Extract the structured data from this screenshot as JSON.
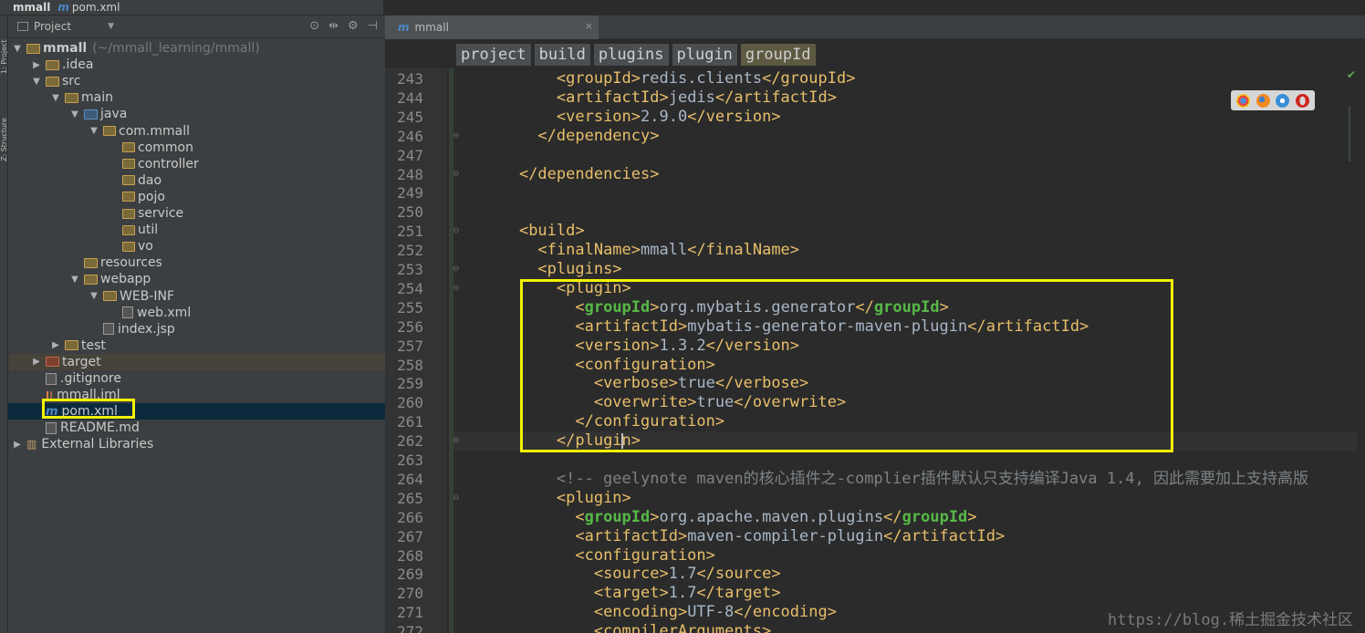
{
  "breadcrumb": {
    "project": "mmall",
    "file": "pom.xml",
    "file_icon": "m"
  },
  "side_strip": {
    "labels": [
      "1: Project",
      "Z: Structure"
    ]
  },
  "project_panel": {
    "title": "Project",
    "dropdown_icon": "chevron-down-icon",
    "tools": [
      "target-icon",
      "collapse-icon",
      "gear-icon",
      "hide-icon"
    ],
    "tree": [
      {
        "label": "mmall",
        "extra": "(~/mmall_learning/mmall)",
        "indent": 0,
        "arrow": "open",
        "icon": "module-folder",
        "bold": true
      },
      {
        "label": ".idea",
        "indent": 1,
        "arrow": "closed",
        "icon": "folder"
      },
      {
        "label": "src",
        "indent": 1,
        "arrow": "open",
        "icon": "folder"
      },
      {
        "label": "main",
        "indent": 2,
        "arrow": "open",
        "icon": "folder"
      },
      {
        "label": "java",
        "indent": 3,
        "arrow": "open",
        "icon": "source-folder"
      },
      {
        "label": "com.mmall",
        "indent": 4,
        "arrow": "open",
        "icon": "package"
      },
      {
        "label": "common",
        "indent": 5,
        "arrow": "",
        "icon": "package"
      },
      {
        "label": "controller",
        "indent": 5,
        "arrow": "",
        "icon": "package"
      },
      {
        "label": "dao",
        "indent": 5,
        "arrow": "",
        "icon": "package"
      },
      {
        "label": "pojo",
        "indent": 5,
        "arrow": "",
        "icon": "package"
      },
      {
        "label": "service",
        "indent": 5,
        "arrow": "",
        "icon": "package"
      },
      {
        "label": "util",
        "indent": 5,
        "arrow": "",
        "icon": "package"
      },
      {
        "label": "vo",
        "indent": 5,
        "arrow": "",
        "icon": "package"
      },
      {
        "label": "resources",
        "indent": 3,
        "arrow": "",
        "icon": "resources-folder"
      },
      {
        "label": "webapp",
        "indent": 3,
        "arrow": "open",
        "icon": "web-folder"
      },
      {
        "label": "WEB-INF",
        "indent": 4,
        "arrow": "open",
        "icon": "folder"
      },
      {
        "label": "web.xml",
        "indent": 5,
        "arrow": "",
        "icon": "xml-file"
      },
      {
        "label": "index.jsp",
        "indent": 4,
        "arrow": "",
        "icon": "jsp-file"
      },
      {
        "label": "test",
        "indent": 2,
        "arrow": "closed",
        "icon": "folder"
      },
      {
        "label": "target",
        "indent": 1,
        "arrow": "closed",
        "icon": "excluded-folder",
        "highlight": true
      },
      {
        "label": ".gitignore",
        "indent": 1,
        "arrow": "",
        "icon": "text-file"
      },
      {
        "label": "mmall.iml",
        "indent": 1,
        "arrow": "",
        "icon": "iml-file"
      },
      {
        "label": "pom.xml",
        "indent": 1,
        "arrow": "",
        "icon": "maven-file",
        "selected": true
      },
      {
        "label": "README.md",
        "indent": 1,
        "arrow": "",
        "icon": "text-file"
      },
      {
        "label": "External Libraries",
        "indent": 0,
        "arrow": "closed",
        "icon": "library"
      }
    ]
  },
  "editor": {
    "tab": {
      "label": "mmall",
      "close": "×"
    },
    "breadcrumbs": [
      "project",
      "build",
      "plugins",
      "plugin",
      "groupId"
    ],
    "browser_icons": [
      "chrome-icon",
      "firefox-icon",
      "safari-icon",
      "opera-icon"
    ],
    "lines": [
      {
        "n": "243",
        "parts": [
          [
            "tx",
            "        "
          ],
          [
            "tg",
            "<groupId>"
          ],
          [
            "tx",
            "redis.clients"
          ],
          [
            "tg",
            "</groupId>"
          ]
        ]
      },
      {
        "n": "244",
        "parts": [
          [
            "tx",
            "        "
          ],
          [
            "tg",
            "<artifactId>"
          ],
          [
            "tx",
            "jedis"
          ],
          [
            "tg",
            "</artifactId>"
          ]
        ]
      },
      {
        "n": "245",
        "parts": [
          [
            "tx",
            "        "
          ],
          [
            "tg",
            "<version>"
          ],
          [
            "tx",
            "2.9.0"
          ],
          [
            "tg",
            "</version>"
          ]
        ]
      },
      {
        "n": "246",
        "parts": [
          [
            "tx",
            "      "
          ],
          [
            "tg",
            "</dependency>"
          ]
        ]
      },
      {
        "n": "247",
        "parts": []
      },
      {
        "n": "248",
        "parts": [
          [
            "tx",
            "    "
          ],
          [
            "tg",
            "</dependencies>"
          ]
        ]
      },
      {
        "n": "249",
        "parts": []
      },
      {
        "n": "250",
        "parts": []
      },
      {
        "n": "251",
        "parts": [
          [
            "tx",
            "    "
          ],
          [
            "tg",
            "<build>"
          ]
        ]
      },
      {
        "n": "252",
        "parts": [
          [
            "tx",
            "      "
          ],
          [
            "tg",
            "<finalName>"
          ],
          [
            "tx",
            "mmall"
          ],
          [
            "tg",
            "</finalName>"
          ]
        ]
      },
      {
        "n": "253",
        "parts": [
          [
            "tx",
            "      "
          ],
          [
            "tg",
            "<plugins>"
          ]
        ]
      },
      {
        "n": "254",
        "parts": [
          [
            "tx",
            "        "
          ],
          [
            "tg",
            "<plugin>"
          ]
        ]
      },
      {
        "n": "255",
        "parts": [
          [
            "tx",
            "          "
          ],
          [
            "tg",
            "<"
          ],
          [
            "gi",
            "groupId"
          ],
          [
            "tg",
            ">"
          ],
          [
            "tx",
            "org.mybatis.generator"
          ],
          [
            "tg",
            "</"
          ],
          [
            "gi",
            "groupId"
          ],
          [
            "tg",
            ">"
          ]
        ]
      },
      {
        "n": "256",
        "parts": [
          [
            "tx",
            "          "
          ],
          [
            "tg",
            "<artifactId>"
          ],
          [
            "tx",
            "mybatis-generator-maven-plugin"
          ],
          [
            "tg",
            "</artifactId>"
          ]
        ]
      },
      {
        "n": "257",
        "parts": [
          [
            "tx",
            "          "
          ],
          [
            "tg",
            "<version>"
          ],
          [
            "tx",
            "1.3.2"
          ],
          [
            "tg",
            "</version>"
          ]
        ]
      },
      {
        "n": "258",
        "parts": [
          [
            "tx",
            "          "
          ],
          [
            "tg",
            "<configuration>"
          ]
        ]
      },
      {
        "n": "259",
        "parts": [
          [
            "tx",
            "            "
          ],
          [
            "tg",
            "<verbose>"
          ],
          [
            "tx",
            "true"
          ],
          [
            "tg",
            "</verbose>"
          ]
        ]
      },
      {
        "n": "260",
        "parts": [
          [
            "tx",
            "            "
          ],
          [
            "tg",
            "<overwrite>"
          ],
          [
            "tx",
            "true"
          ],
          [
            "tg",
            "</overwrite>"
          ]
        ]
      },
      {
        "n": "261",
        "parts": [
          [
            "tx",
            "          "
          ],
          [
            "tg",
            "</configuration>"
          ]
        ]
      },
      {
        "n": "262",
        "parts": [
          [
            "tx",
            "        "
          ],
          [
            "tg",
            "</plugin>"
          ]
        ]
      },
      {
        "n": "263",
        "parts": []
      },
      {
        "n": "264",
        "parts": [
          [
            "cm",
            "        <!-- geelynote maven的核心插件之-complier插件默认只支持编译Java 1.4, 因此需要加上支持高版"
          ]
        ]
      },
      {
        "n": "265",
        "parts": [
          [
            "tx",
            "        "
          ],
          [
            "tg",
            "<plugin>"
          ]
        ]
      },
      {
        "n": "266",
        "parts": [
          [
            "tx",
            "          "
          ],
          [
            "tg",
            "<"
          ],
          [
            "gi",
            "groupId"
          ],
          [
            "tg",
            ">"
          ],
          [
            "tx",
            "org.apache.maven.plugins"
          ],
          [
            "tg",
            "</"
          ],
          [
            "gi",
            "groupId"
          ],
          [
            "tg",
            ">"
          ]
        ]
      },
      {
        "n": "267",
        "parts": [
          [
            "tx",
            "          "
          ],
          [
            "tg",
            "<artifactId>"
          ],
          [
            "tx",
            "maven-compiler-plugin"
          ],
          [
            "tg",
            "</artifactId>"
          ]
        ]
      },
      {
        "n": "268",
        "parts": [
          [
            "tx",
            "          "
          ],
          [
            "tg",
            "<configuration>"
          ]
        ]
      },
      {
        "n": "269",
        "parts": [
          [
            "tx",
            "            "
          ],
          [
            "tg",
            "<source>"
          ],
          [
            "tx",
            "1.7"
          ],
          [
            "tg",
            "</source>"
          ]
        ]
      },
      {
        "n": "270",
        "parts": [
          [
            "tx",
            "            "
          ],
          [
            "tg",
            "<target>"
          ],
          [
            "tx",
            "1.7"
          ],
          [
            "tg",
            "</target>"
          ]
        ]
      },
      {
        "n": "271",
        "parts": [
          [
            "tx",
            "            "
          ],
          [
            "tg",
            "<encoding>"
          ],
          [
            "tx",
            "UTF-8"
          ],
          [
            "tg",
            "</encoding>"
          ]
        ]
      },
      {
        "n": "272",
        "parts": [
          [
            "tx",
            "            "
          ],
          [
            "tg",
            "<compilerArguments>"
          ]
        ]
      }
    ],
    "watermark": "https://blog.稀土掘金技术社区"
  },
  "colors": {
    "tag": "#e8bf6a",
    "text": "#a9b7c6",
    "highlight_box": "#f2f200",
    "bg": "#2b2b2b"
  }
}
